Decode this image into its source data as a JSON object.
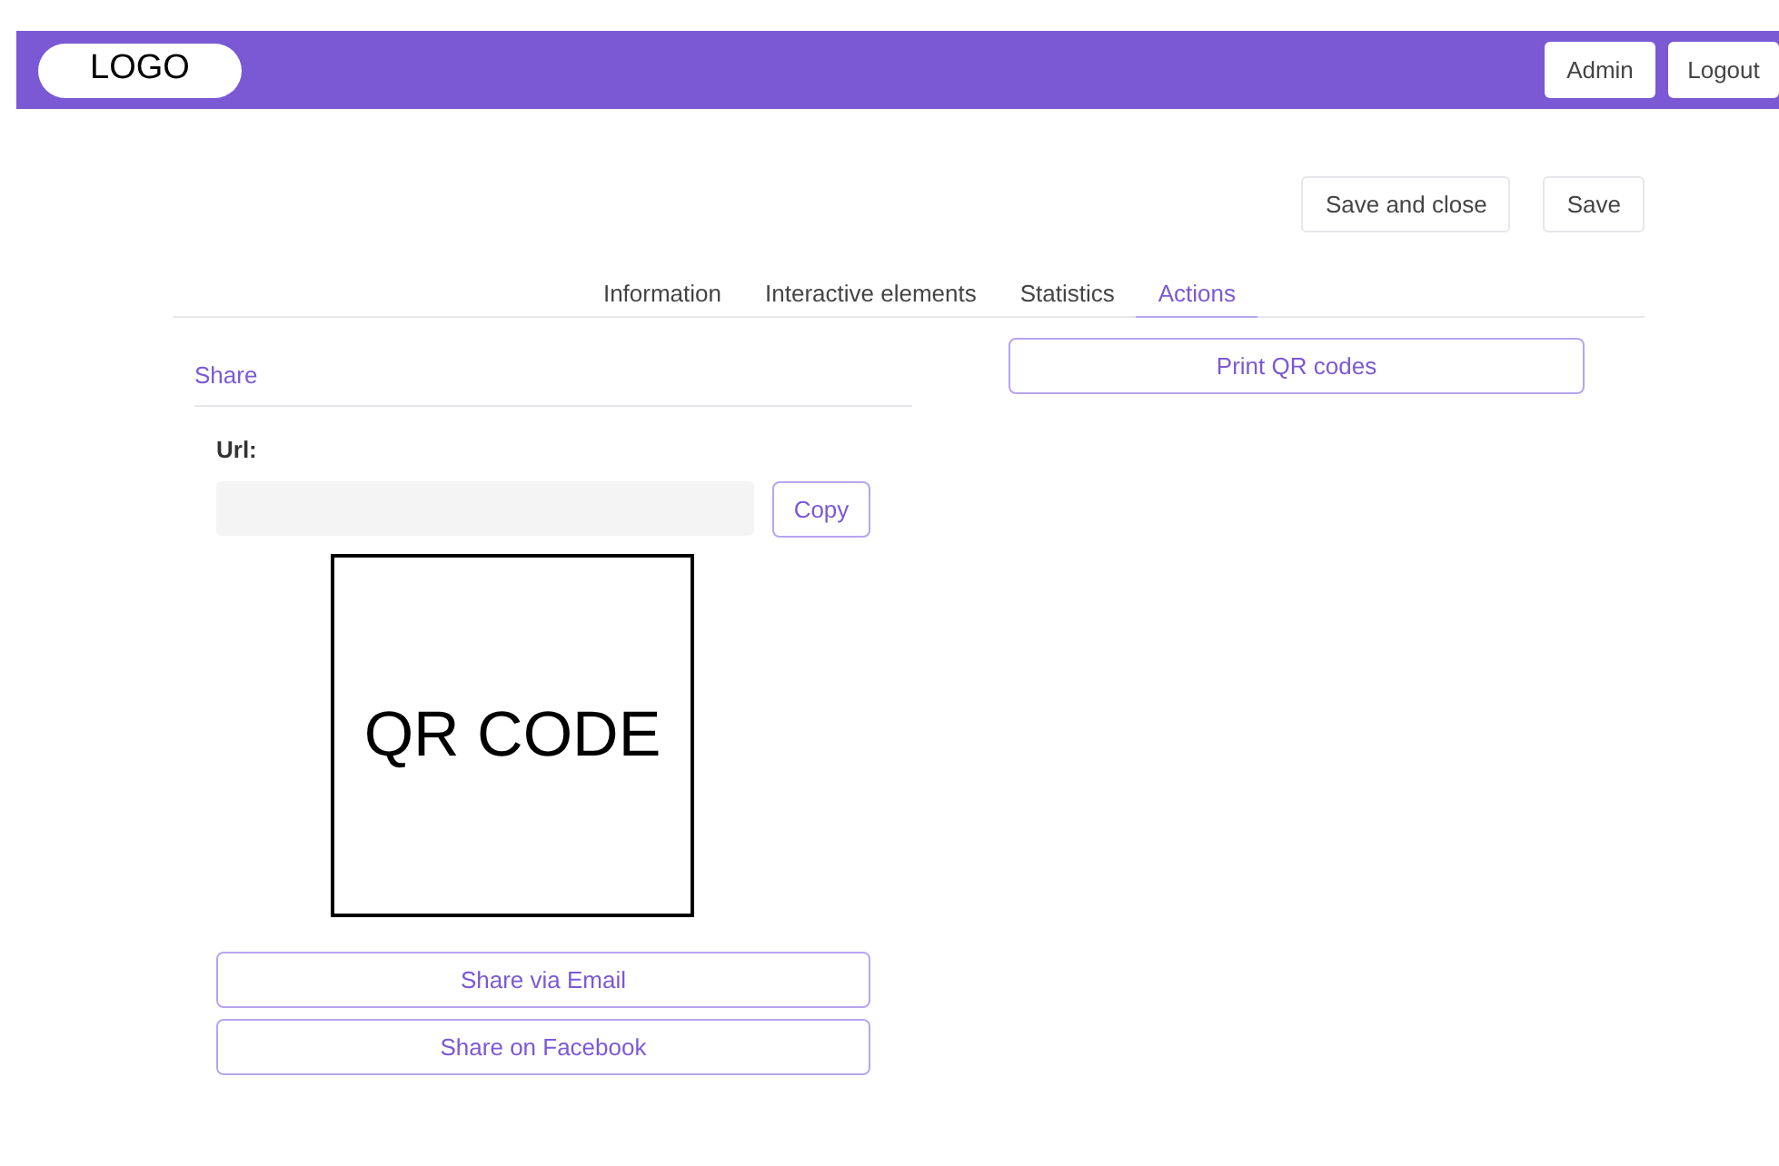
{
  "header": {
    "logo": "LOGO",
    "buttons": [
      "Admin",
      "Logout"
    ]
  },
  "toolbar": {
    "buttons": [
      "Save and close",
      "Save"
    ]
  },
  "tabs": [
    {
      "label": "Information",
      "selected": false
    },
    {
      "label": "Interactive elements",
      "selected": false
    },
    {
      "label": "Statistics",
      "selected": false
    },
    {
      "label": "Actions",
      "selected": true
    }
  ],
  "share": {
    "title": "Share",
    "url_label": "Url:",
    "copy_button": "Copy",
    "qr_placeholder": "QR CODE",
    "buttons": [
      "Share via Email",
      "Share on Facebook"
    ]
  },
  "print_button": "Print QR codes"
}
